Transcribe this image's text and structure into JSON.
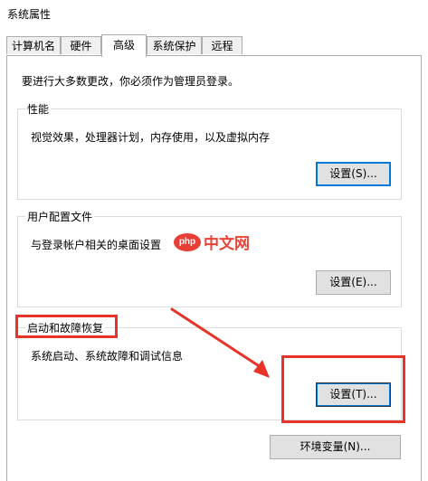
{
  "window": {
    "title": "系统属性"
  },
  "tabs": [
    {
      "label": "计算机名"
    },
    {
      "label": "硬件"
    },
    {
      "label": "高级",
      "active": true
    },
    {
      "label": "系统保护"
    },
    {
      "label": "远程"
    }
  ],
  "main": {
    "intro": "要进行大多数更改，你必须作为管理员登录。",
    "performance": {
      "title": "性能",
      "desc": "视觉效果，处理器计划，内存使用，以及虚拟内存",
      "button": "设置(S)..."
    },
    "user_profiles": {
      "title": "用户配置文件",
      "desc": "与登录帐户相关的桌面设置",
      "button": "设置(E)..."
    },
    "startup_recovery": {
      "title": "启动和故障恢复",
      "desc": "系统启动、系统故障和调试信息",
      "button": "设置(T)..."
    },
    "env_button": "环境变量(N)..."
  },
  "watermark": {
    "badge": "php",
    "text": "中文网"
  },
  "colors": {
    "annotation": "#e8332b",
    "accent": "#0078d7",
    "button_face": "#e1e1e1"
  },
  "icons": {
    "annotation_arrow": "arrow-icon"
  }
}
